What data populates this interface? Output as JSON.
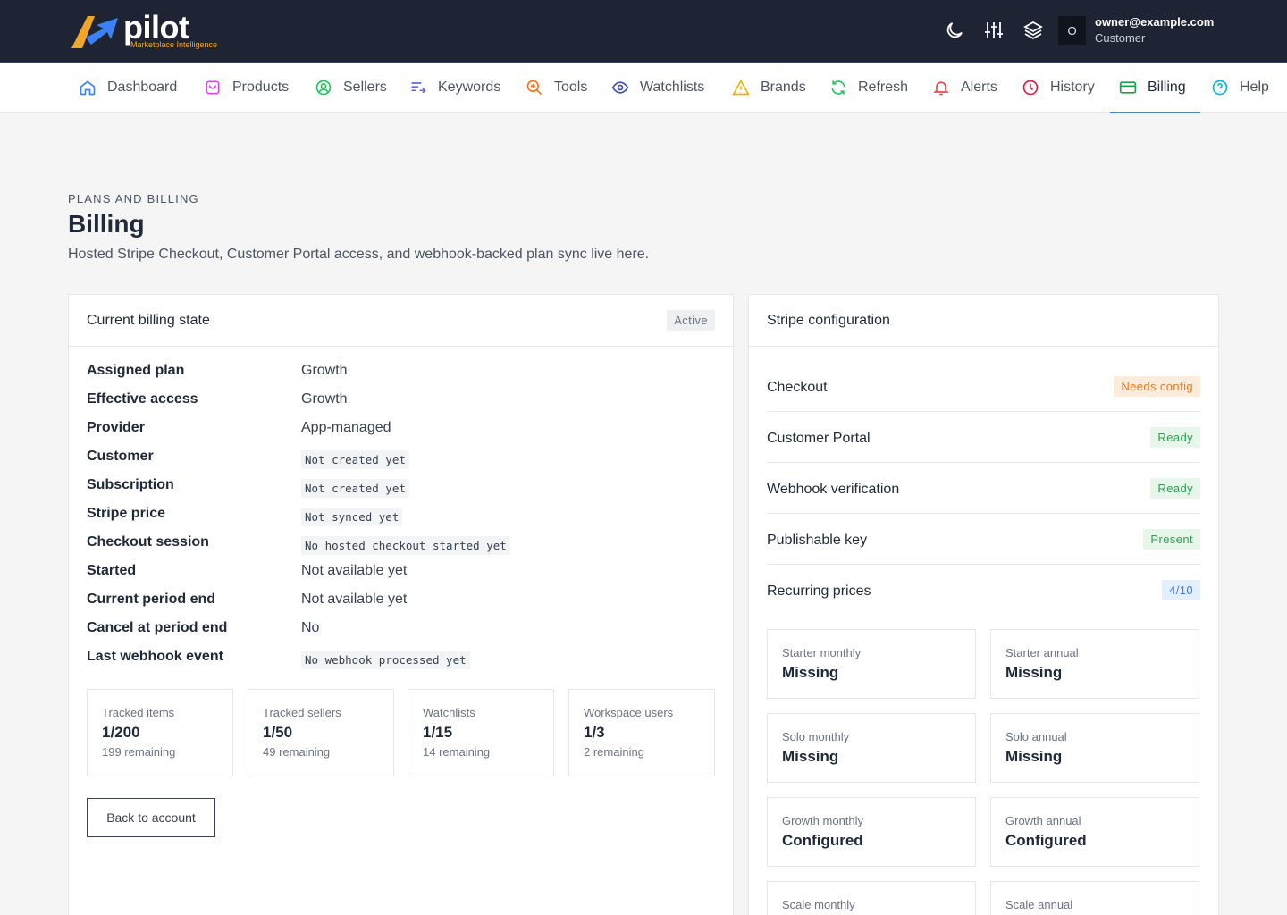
{
  "brand": {
    "name": "pilot",
    "tagline": "Marketplace Intelligence"
  },
  "topbar": {
    "icons": [
      "moon-icon",
      "sliders-icon",
      "layers-icon"
    ],
    "user": {
      "initial": "O",
      "email": "owner@example.com",
      "role": "Customer"
    }
  },
  "nav": {
    "items": [
      {
        "label": "Dashboard",
        "icon": "home-icon",
        "color": "#3b82f6"
      },
      {
        "label": "Products",
        "icon": "bag-icon",
        "color": "#d946ef"
      },
      {
        "label": "Sellers",
        "icon": "user-circle-icon",
        "color": "#22c55e"
      },
      {
        "label": "Keywords",
        "icon": "list-arrow-icon",
        "color": "#6366f1"
      },
      {
        "label": "Tools",
        "icon": "zoom-plus-icon",
        "color": "#f97316"
      },
      {
        "label": "Watchlists",
        "icon": "eye-icon",
        "color": "#3b4bb8"
      },
      {
        "label": "Brands",
        "icon": "warning-icon",
        "color": "#eab308"
      },
      {
        "label": "Refresh",
        "icon": "refresh-icon",
        "color": "#22c55e"
      },
      {
        "label": "Alerts",
        "icon": "bell-icon",
        "color": "#ef4444"
      },
      {
        "label": "History",
        "icon": "clock-icon",
        "color": "#e11d48"
      },
      {
        "label": "Billing",
        "icon": "card-icon",
        "color": "#16a34a"
      },
      {
        "label": "Help",
        "icon": "help-icon",
        "color": "#06b6d4"
      }
    ],
    "active": "Billing"
  },
  "header": {
    "eyebrow": "PLANS AND BILLING",
    "title": "Billing",
    "subtitle": "Hosted Stripe Checkout, Customer Portal access, and webhook-backed plan sync live here."
  },
  "billing_state": {
    "title": "Current billing state",
    "status": "Active",
    "rows": [
      {
        "key": "Assigned plan",
        "value": "Growth",
        "code": false
      },
      {
        "key": "Effective access",
        "value": "Growth",
        "code": false
      },
      {
        "key": "Provider",
        "value": "App-managed",
        "code": false
      },
      {
        "key": "Customer",
        "value": "Not created yet",
        "code": true
      },
      {
        "key": "Subscription",
        "value": "Not created yet",
        "code": true
      },
      {
        "key": "Stripe price",
        "value": "Not synced yet",
        "code": true
      },
      {
        "key": "Checkout session",
        "value": "No hosted checkout started yet",
        "code": true
      },
      {
        "key": "Started",
        "value": "Not available yet",
        "code": false
      },
      {
        "key": "Current period end",
        "value": "Not available yet",
        "code": false
      },
      {
        "key": "Cancel at period end",
        "value": "No",
        "code": false
      },
      {
        "key": "Last webhook event",
        "value": "No webhook processed yet",
        "code": true
      }
    ],
    "usage": [
      {
        "label": "Tracked items",
        "value": "1/200",
        "remaining": "199 remaining"
      },
      {
        "label": "Tracked sellers",
        "value": "1/50",
        "remaining": "49 remaining"
      },
      {
        "label": "Watchlists",
        "value": "1/15",
        "remaining": "14 remaining"
      },
      {
        "label": "Workspace users",
        "value": "1/3",
        "remaining": "2 remaining"
      }
    ],
    "back_label": "Back to account"
  },
  "stripe_config": {
    "title": "Stripe configuration",
    "rows": [
      {
        "key": "Checkout",
        "status": "Needs config",
        "tone": "orange"
      },
      {
        "key": "Customer Portal",
        "status": "Ready",
        "tone": "green"
      },
      {
        "key": "Webhook verification",
        "status": "Ready",
        "tone": "green"
      },
      {
        "key": "Publishable key",
        "status": "Present",
        "tone": "green"
      },
      {
        "key": "Recurring prices",
        "status": "4/10",
        "tone": "blue"
      }
    ],
    "prices": [
      {
        "label": "Starter monthly",
        "value": "Missing"
      },
      {
        "label": "Starter annual",
        "value": "Missing"
      },
      {
        "label": "Solo monthly",
        "value": "Missing"
      },
      {
        "label": "Solo annual",
        "value": "Missing"
      },
      {
        "label": "Growth monthly",
        "value": "Configured"
      },
      {
        "label": "Growth annual",
        "value": "Configured"
      },
      {
        "label": "Scale monthly",
        "value": ""
      },
      {
        "label": "Scale annual",
        "value": ""
      }
    ]
  }
}
